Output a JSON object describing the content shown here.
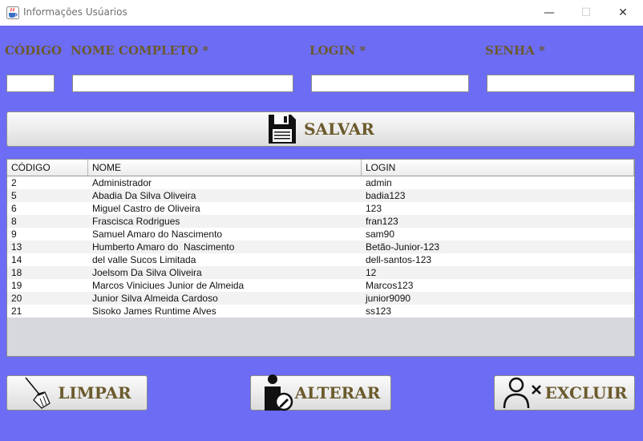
{
  "window": {
    "title": "Informações Usúarios",
    "minimize_glyph": "—",
    "maximize_glyph": "☐",
    "close_glyph": "✕"
  },
  "form": {
    "codigo_label": "CÓDIGO",
    "nome_label": "NOME COMPLETO *",
    "login_label": "LOGIN *",
    "senha_label": "SENHA *",
    "codigo_value": "",
    "nome_value": "",
    "login_value": "",
    "senha_value": ""
  },
  "buttons": {
    "salvar": "SALVAR",
    "limpar": "LIMPAR",
    "alterar": "ALTERAR",
    "excluir": "EXCLUIR"
  },
  "table": {
    "columns": [
      "CÓDIGO",
      "NOME",
      "LOGIN"
    ],
    "rows": [
      [
        "2",
        "Administrador",
        "admin"
      ],
      [
        "5",
        "Abadia Da Silva Oliveira",
        "badia123"
      ],
      [
        "6",
        "Miguel Castro de Oliveira",
        "123"
      ],
      [
        "8",
        "Frascisca Rodrigues",
        "fran123"
      ],
      [
        "9",
        "Samuel Amaro do Nascimento",
        "sam90"
      ],
      [
        "13",
        "Humberto Amaro do  Nascimento",
        "Betão-Junior-123"
      ],
      [
        "14",
        "del valle Sucos Limitada",
        "dell-santos-123"
      ],
      [
        "18",
        "Joelsom Da Silva Oliveira",
        "12"
      ],
      [
        "19",
        "Marcos Viniciues Junior de Almeida",
        "Marcos123"
      ],
      [
        "20",
        "Junior Silva Almeida Cardoso",
        "junior9090"
      ],
      [
        "21",
        "Sisoko James Runtime Alves",
        "ss123"
      ]
    ]
  },
  "icons": {
    "app": "java-cup-icon",
    "salvar": "floppy-disk-icon",
    "limpar": "broom-icon",
    "alterar": "user-edit-icon",
    "excluir": "user-remove-icon"
  },
  "colors": {
    "background": "#6c6cf5",
    "label_text": "#6b5a2c"
  }
}
